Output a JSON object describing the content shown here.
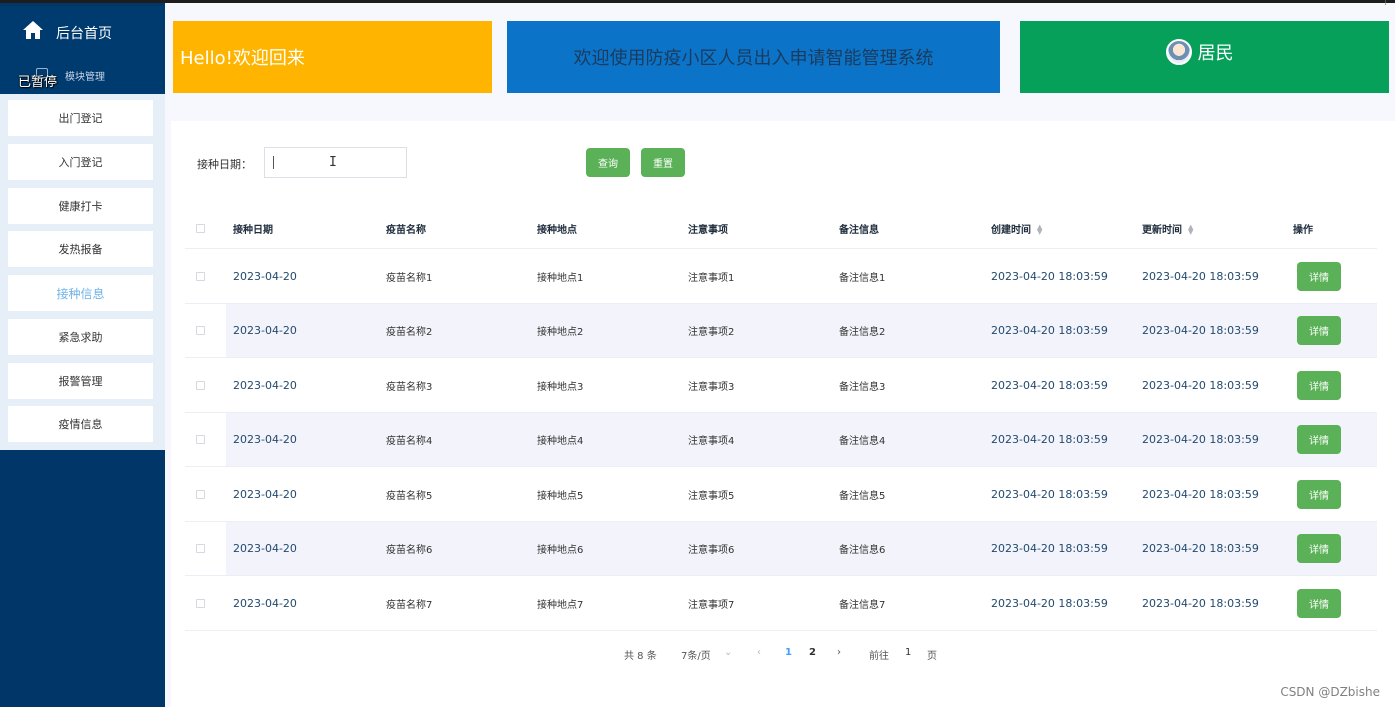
{
  "sidebar": {
    "home_label": "后台首页",
    "module_label": "模块管理",
    "paused_label": "已暂停",
    "items": [
      {
        "label": "出门登记"
      },
      {
        "label": "入门登记"
      },
      {
        "label": "健康打卡"
      },
      {
        "label": "发热报备"
      },
      {
        "label": "接种信息"
      },
      {
        "label": "紧急求助"
      },
      {
        "label": "报警管理"
      },
      {
        "label": "疫情信息"
      }
    ],
    "active_index": 4
  },
  "header": {
    "hello": "Hello!欢迎回来",
    "system_title": "欢迎使用防疫小区人员出入申请智能管理系统",
    "user_role": "居民",
    "colors": {
      "hello": "#ffb400",
      "system": "#0b74c9",
      "user": "#06a05a"
    }
  },
  "search": {
    "label": "接种日期：",
    "value": "",
    "query_button": "查询",
    "reset_button": "重置"
  },
  "table": {
    "columns": [
      "接种日期",
      "疫苗名称",
      "接种地点",
      "注意事项",
      "备注信息",
      "创建时间",
      "更新时间",
      "操作"
    ],
    "rows": [
      {
        "date": "2023-04-20",
        "name": "疫苗名称1",
        "place": "接种地点1",
        "note": "注意事项1",
        "remark": "备注信息1",
        "created": "2023-04-20 18:03:59",
        "updated": "2023-04-20 18:03:59",
        "action": "详情"
      },
      {
        "date": "2023-04-20",
        "name": "疫苗名称2",
        "place": "接种地点2",
        "note": "注意事项2",
        "remark": "备注信息2",
        "created": "2023-04-20 18:03:59",
        "updated": "2023-04-20 18:03:59",
        "action": "详情"
      },
      {
        "date": "2023-04-20",
        "name": "疫苗名称3",
        "place": "接种地点3",
        "note": "注意事项3",
        "remark": "备注信息3",
        "created": "2023-04-20 18:03:59",
        "updated": "2023-04-20 18:03:59",
        "action": "详情"
      },
      {
        "date": "2023-04-20",
        "name": "疫苗名称4",
        "place": "接种地点4",
        "note": "注意事项4",
        "remark": "备注信息4",
        "created": "2023-04-20 18:03:59",
        "updated": "2023-04-20 18:03:59",
        "action": "详情"
      },
      {
        "date": "2023-04-20",
        "name": "疫苗名称5",
        "place": "接种地点5",
        "note": "注意事项5",
        "remark": "备注信息5",
        "created": "2023-04-20 18:03:59",
        "updated": "2023-04-20 18:03:59",
        "action": "详情"
      },
      {
        "date": "2023-04-20",
        "name": "疫苗名称6",
        "place": "接种地点6",
        "note": "注意事项6",
        "remark": "备注信息6",
        "created": "2023-04-20 18:03:59",
        "updated": "2023-04-20 18:03:59",
        "action": "详情"
      },
      {
        "date": "2023-04-20",
        "name": "疫苗名称7",
        "place": "接种地点7",
        "note": "注意事项7",
        "remark": "备注信息7",
        "created": "2023-04-20 18:03:59",
        "updated": "2023-04-20 18:03:59",
        "action": "详情"
      }
    ]
  },
  "pagination": {
    "total": "共 8 条",
    "page_size": "7条/页",
    "pages": [
      "1",
      "2"
    ],
    "current_page": "1",
    "goto_label": "前往",
    "goto_value": "1",
    "unit": "页"
  },
  "watermark": "CSDN @DZbishe"
}
